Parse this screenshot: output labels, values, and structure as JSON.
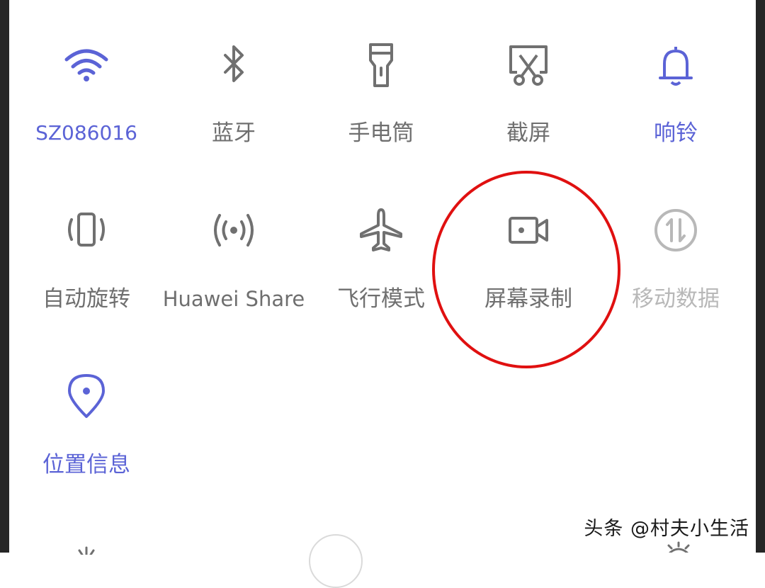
{
  "colors": {
    "active": "#5b63d6",
    "inactive": "#6f6f6f",
    "disabled": "#b8b8b8",
    "highlight": "#e01010"
  },
  "tiles": [
    {
      "icon": "wifi-icon",
      "label": "SZ086016",
      "state": "active"
    },
    {
      "icon": "bluetooth-icon",
      "label": "蓝牙",
      "state": "inactive"
    },
    {
      "icon": "flashlight-icon",
      "label": "手电筒",
      "state": "inactive"
    },
    {
      "icon": "screenshot-scissors-icon",
      "label": "截屏",
      "state": "inactive"
    },
    {
      "icon": "bell-icon",
      "label": "响铃",
      "state": "active"
    },
    {
      "icon": "auto-rotate-icon",
      "label": "自动旋转",
      "state": "inactive"
    },
    {
      "icon": "huawei-share-icon",
      "label": "Huawei Share",
      "state": "inactive"
    },
    {
      "icon": "airplane-icon",
      "label": "飞行模式",
      "state": "inactive"
    },
    {
      "icon": "screen-record-icon",
      "label": "屏幕录制",
      "state": "inactive",
      "highlighted": true
    },
    {
      "icon": "mobile-data-icon",
      "label": "移动数据",
      "state": "disabled"
    },
    {
      "icon": "location-pin-icon",
      "label": "位置信息",
      "state": "active"
    }
  ],
  "watermark": "头条 @村夫小生活"
}
